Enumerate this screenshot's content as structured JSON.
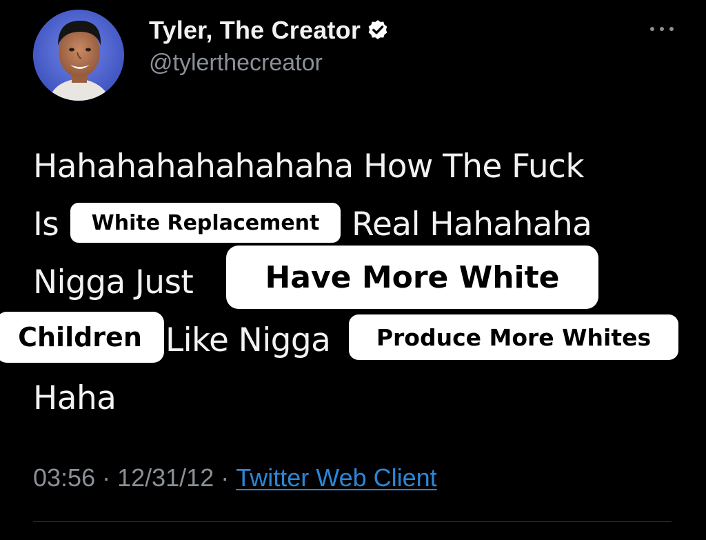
{
  "tweet": {
    "author": {
      "display_name": "Tyler, The Creator",
      "handle": "@tylerthecreator",
      "verified": true,
      "avatar_icon": "profile-photo-icon"
    },
    "text_lines": [
      [
        "Hahahahahahahaha How The Fuck"
      ],
      [
        "Is",
        "Real Hahahaha"
      ],
      [
        "Nigga Just"
      ],
      [
        "Like Nigga"
      ],
      [
        "Haha"
      ]
    ],
    "overlay_labels": {
      "white_replacement": "White Replacement",
      "have_more_white": "Have More White",
      "children": "Children",
      "produce_more_whites": "Produce More Whites"
    },
    "meta": {
      "time": "03:56",
      "separator": "·",
      "date": "12/31/12",
      "client": "Twitter Web Client"
    }
  },
  "colors": {
    "background": "#000000",
    "text": "#f2f2f2",
    "muted": "#8b9096",
    "link": "#2b86d6",
    "label_bg": "#ffffff",
    "label_text": "#000000"
  }
}
